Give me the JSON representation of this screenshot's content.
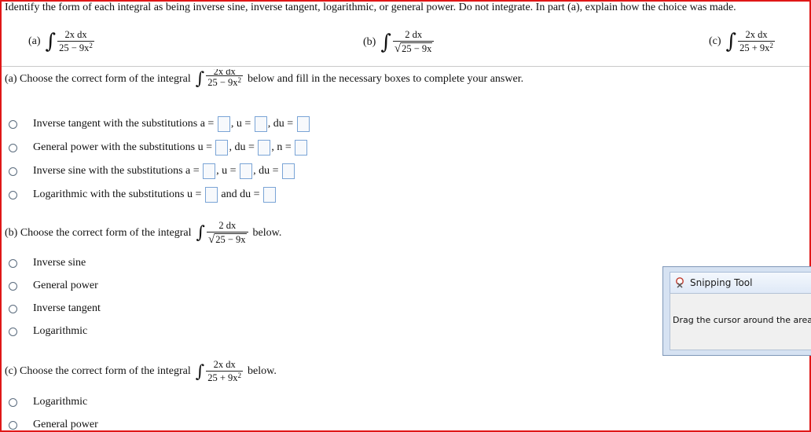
{
  "header": {
    "instructions": "Identify the form of each integral as being inverse sine, inverse tangent, logarithmic, or general power. Do not integrate. In part (a), explain how the choice was made."
  },
  "integrals": {
    "a": {
      "label": "(a)",
      "numerator": "2x dx",
      "denominator": "25 − 9x",
      "exponent": "2"
    },
    "b": {
      "label": "(b)",
      "numerator": "2 dx",
      "denominator_radical": "√",
      "denominator": "25 − 9x"
    },
    "c": {
      "label": "(c)",
      "numerator": "2x dx",
      "denominator": "25 + 9x",
      "exponent": "2"
    }
  },
  "part_a": {
    "prompt": "(a) Choose the correct form of the integral",
    "suffix": "below and fill in the necessary boxes to complete your answer.",
    "options": [
      {
        "t1": "Inverse tangent with the substitutions a =",
        "t2": ", u =",
        "t3": ", du ="
      },
      {
        "t1": "General power with the substitutions u =",
        "t2": ", du =",
        "t3": ", n ="
      },
      {
        "t1": "Inverse sine with the substitutions a =",
        "t2": ", u =",
        "t3": ", du ="
      },
      {
        "t1": "Logarithmic with the substitutions u =",
        "t2": "and du ="
      }
    ]
  },
  "part_b": {
    "prompt": "(b) Choose the correct form of the integral",
    "suffix": "below.",
    "options": [
      "Inverse sine",
      "General power",
      "Inverse tangent",
      "Logarithmic"
    ]
  },
  "part_c": {
    "prompt": "(c) Choose the correct form of the integral",
    "suffix": "below.",
    "options": [
      "Logarithmic",
      "General power"
    ]
  },
  "snipping_tool": {
    "title": "Snipping Tool",
    "message": "Drag the cursor around the area you w"
  },
  "colors": {
    "frame_border": "#e01818",
    "answer_box_border": "#7aa4d6",
    "divider": "#c9c9c9"
  }
}
